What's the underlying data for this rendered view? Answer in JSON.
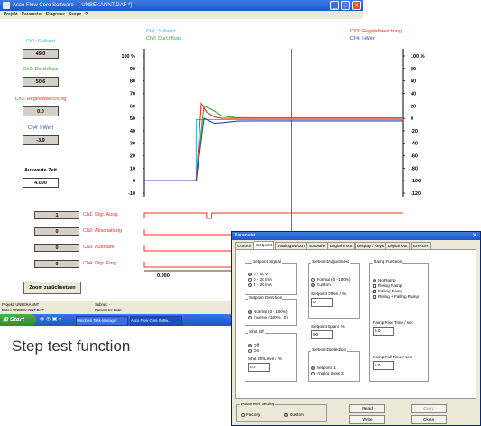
{
  "window": {
    "title": "Asco Flow Core Software - [ UNBEKANNT.DAF *]",
    "controls": [
      "_",
      "□",
      "✕"
    ]
  },
  "menu": [
    "Projekt",
    "Parameter",
    "Diagnose",
    "Scope",
    "?"
  ],
  "channels": [
    {
      "label": "Ch1: Sollwert",
      "value": "49.0",
      "color": "#33bbdd"
    },
    {
      "label": "Ch2: Durchfluss",
      "value": "50.6",
      "color": "#33aa33"
    },
    {
      "label": "Ch3: Regelabweichung",
      "value": "0.0",
      "color": "#ee3322"
    },
    {
      "label": "Ch4: I-Wert",
      "value": "-3.9",
      "color": "#2244bb"
    }
  ],
  "auswerte": {
    "label": "Auswerte Zeit",
    "value": "4.000"
  },
  "legend_top": {
    "left1": "Ch1: Sollwert",
    "left2": "Ch2: Durchfluss",
    "right1": "Ch3: Regelabweichung",
    "right2": "Ch4: I-Wert"
  },
  "chart_data": {
    "type": "line",
    "yticks_left": [
      "100 %",
      "90",
      "80",
      "70",
      "60",
      "50",
      "40",
      "30",
      "20",
      "10",
      "0",
      "-10"
    ],
    "yticks_right": [
      "100 %",
      "80",
      "60",
      "40",
      "20",
      "0",
      "-20",
      "-40",
      "-60",
      "-80",
      "-100",
      "-120"
    ],
    "ylim_left": [
      -10,
      100
    ],
    "ylim_right": [
      -120,
      100
    ],
    "series": [
      {
        "name": "Ch1: Sollwert",
        "color": "#33bbdd",
        "x": [
          0,
          0.2,
          0.2,
          1
        ],
        "y": [
          0,
          0,
          49,
          49
        ]
      },
      {
        "name": "Ch2: Durchfluss",
        "color": "#33aa33",
        "x": [
          0,
          0.2,
          0.21,
          0.23,
          0.26,
          0.3,
          0.35,
          0.45,
          1
        ],
        "y": [
          0,
          0,
          22,
          60,
          57,
          52,
          50.6,
          50.4,
          50.4
        ]
      },
      {
        "name": "Ch3: Regelabweichung",
        "color": "#ee3322",
        "x": [
          0,
          0.2,
          0.21,
          0.22,
          0.24,
          0.27,
          0.3,
          0.35,
          1
        ],
        "y": [
          0,
          0,
          32,
          62,
          55,
          51,
          50,
          50,
          50
        ]
      },
      {
        "name": "Ch4: I-Wert",
        "color": "#2244bb",
        "x": [
          0,
          0.2,
          0.23,
          0.27,
          0.3,
          0.36,
          0.45,
          1
        ],
        "y": [
          0,
          0,
          50,
          46,
          46.5,
          47.8,
          48,
          48
        ]
      }
    ],
    "x_cursor": 0.57,
    "x_end_label": "0.000"
  },
  "digital": [
    {
      "value": "1",
      "label": "Ch1: Digi. Ausg."
    },
    {
      "value": "0",
      "label": "Ch2: Abschaltung"
    },
    {
      "value": "0",
      "label": "Ch3: Autosafe"
    },
    {
      "value": "0",
      "label": "Ch4: Digi. Eing."
    }
  ],
  "zoom_button": "Zoom zurücksetzen",
  "status": {
    "projekt": "Projekt: UNBEKANNT",
    "datei": "Datei: UNBEKANNT.DAF",
    "subnet": "Subnet: -",
    "parameter_satz": "Parameter Satz: --"
  },
  "taskbar": {
    "start": "Start",
    "items": [
      "Windows Task-Manager",
      "Asco Flow Core Softw..."
    ]
  },
  "caption": "Step test function",
  "dialog": {
    "title": "Parameter",
    "tabs": [
      "Control",
      "Setpoint",
      "Analog IN/OUT",
      "Autosafe",
      "Digital Input",
      "Display / Keys",
      "Digital Out",
      "ERROR"
    ],
    "setpoint_signal": {
      "title": "Setpoint Signal",
      "options": [
        "0 - 10 V",
        "0 - 20 mA",
        "4 - 20 mA"
      ]
    },
    "setpoint_direction": {
      "title": "Setpoint Direction",
      "options": [
        "Normal (0 - 100%)",
        "Inverse (100% - 0)"
      ]
    },
    "shut_off": {
      "title": "Shut Off",
      "options": [
        "Off",
        "On"
      ],
      "level_label": "Shut Off Level / %",
      "level_value": "0.5"
    },
    "setpoint_adjustment": {
      "title": "Setpoint Adjustment",
      "options": [
        "Normal (0 - 100%)",
        "Custom"
      ],
      "offset_label": "Setpoint Offset / %",
      "offset_value": "0",
      "span_label": "Setpoint Span / %",
      "span_value": "90"
    },
    "setpoint_selection": {
      "title": "Setpoint Selection",
      "options": [
        "Setpoint 1",
        "Analog Input 2"
      ]
    },
    "ramp_function": {
      "title": "Ramp Function",
      "options": [
        "No Ramp",
        "Rising Ramp",
        "Falling Ramp",
        "Rising + Falling Ramp"
      ],
      "rise_label": "Ramp Rise Time / sec",
      "rise_value": "5.0",
      "fall_label": "Ramp Fall Time / sec",
      "fall_value": "5.0"
    },
    "parameter_setting": {
      "title": "Parameter Setting",
      "options": [
        "Factory",
        "Custom"
      ]
    },
    "buttons": {
      "read": "Read",
      "write": "Write",
      "copy": "Copy",
      "close": "Close"
    }
  }
}
